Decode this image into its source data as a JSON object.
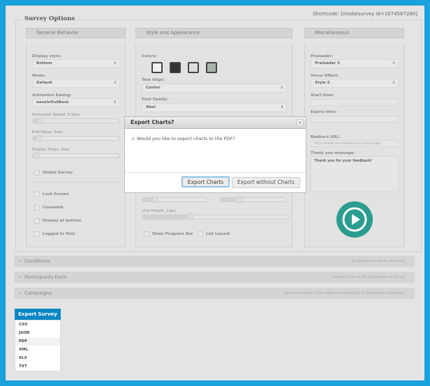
{
  "shortcode": "Shortcode: [modalsurvey id=1674587280]",
  "fieldset_title": "Survey Options",
  "columns": {
    "general": {
      "title": "General Behavior",
      "display_style_label": "Display style:",
      "display_style": "Bottom",
      "mode_label": "Mode:",
      "mode": "Default",
      "easing_label": "Animation Easing:",
      "easing": "easeInOutBack",
      "anim_speed": "Animation Speed: 0.5sec",
      "anim_speed_fraction": 0.05,
      "end_delay": "End Delay: 5sec",
      "end_delay_fraction": 0.03,
      "display_timer": "Display Timer: 0sec",
      "display_timer_fraction": 0.0,
      "global_survey": "Global Survey",
      "lock_screen": "Lock Screen",
      "closeable": "Closeable",
      "display_bottom": "Display at bottom",
      "logged_in": "Logged In Only"
    },
    "style": {
      "title": "Style and Appearance",
      "colors_label": "Colors:",
      "text_align_label": "Text Align:",
      "text_align": "Center",
      "font_family_label": "Font Family:",
      "font_family": "Abel",
      "slider_a_fraction": 0.15,
      "slider_b_fraction": 0.25,
      "line_height": "Line Height: 12px",
      "line_height_fraction": 0.3,
      "show_progress": "Show Progress Bar",
      "list_layout": "List Layout"
    },
    "misc": {
      "title": "Miscellaneous",
      "preloader_label": "Preloader:",
      "preloader": "Preloader 5",
      "hover_label": "Hover Effect:",
      "hover": "Style 5",
      "start_label": "Start time:",
      "expiry_label": "Expiry time:",
      "redirect_label": "Redirect URL:",
      "redirect_placeholder": "http://www.yourwebsiteurl.com/subpa",
      "thanks_label": "Thank you message:",
      "thanks": "Thank you for your feedback!"
    }
  },
  "accordions": [
    {
      "title": "Conditions",
      "desc": "Set Actions based on the Votes"
    },
    {
      "title": "Participants Form",
      "desc": "Display Form at the Completion of Survey"
    },
    {
      "title": "Campaigns",
      "desc": "Save the survey's form datas automatically to Newsletter Campaigns"
    }
  ],
  "export": {
    "label": "Export Survey",
    "options": [
      "CSV",
      "JSON",
      "PDF",
      "XML",
      "XLS",
      "TXT"
    ]
  },
  "dialog": {
    "title": "Export Charts?",
    "close": "×",
    "message": "Would you like to export charts to the PDF?",
    "warning_icon": "⚠",
    "export_charts": "Export Charts",
    "export_without": "Export without Charts"
  },
  "colors": {
    "accent": "#1ba1dc",
    "play": "#2a9d8f"
  }
}
